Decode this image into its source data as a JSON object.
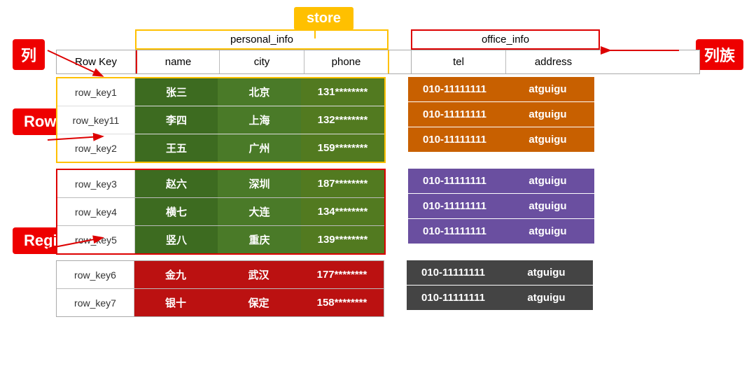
{
  "store_label": "store",
  "lie_label": "列",
  "liezu_label": "列族",
  "rowkey_label": "Row key",
  "region_label": "Region",
  "family_personal": "personal_info",
  "family_office": "office_info",
  "col_headers": [
    "Row Key",
    "name",
    "city",
    "phone",
    "tel",
    "address"
  ],
  "region1": {
    "rows": [
      {
        "key": "row_key1",
        "name": "张三",
        "city": "北京",
        "phone": "131********",
        "tel": "010-11111111",
        "address": "atguigu"
      },
      {
        "key": "row_key11",
        "name": "李四",
        "city": "上海",
        "phone": "132********",
        "tel": "010-11111111",
        "address": "atguigu"
      },
      {
        "key": "row_key2",
        "name": "王五",
        "city": "广州",
        "phone": "159********",
        "tel": "010-11111111",
        "address": "atguigu"
      }
    ]
  },
  "region2": {
    "rows": [
      {
        "key": "row_key3",
        "name": "赵六",
        "city": "深圳",
        "phone": "187********",
        "tel": "010-11111111",
        "address": "atguigu"
      },
      {
        "key": "row_key4",
        "name": "横七",
        "city": "大连",
        "phone": "134********",
        "tel": "010-11111111",
        "address": "atguigu"
      },
      {
        "key": "row_key5",
        "name": "竖八",
        "city": "重庆",
        "phone": "139********",
        "tel": "010-11111111",
        "address": "atguigu"
      }
    ]
  },
  "region3": {
    "rows": [
      {
        "key": "row_key6",
        "name": "金九",
        "city": "武汉",
        "phone": "177********",
        "tel": "010-11111111",
        "address": "atguigu"
      },
      {
        "key": "row_key7",
        "name": "银十",
        "city": "保定",
        "phone": "158********",
        "tel": "010-11111111",
        "address": "atguigu"
      }
    ]
  },
  "colors": {
    "store_bg": "#FFC000",
    "lie_bg": "#dd0000",
    "green_dark": "#3d6b20",
    "green_mid": "#4a7a28",
    "green_light": "#527a20",
    "orange": "#c86000",
    "purple_dark": "#6a4fa0",
    "purple_mid": "#7a5ab0",
    "purple_light": "#8a65c0",
    "red_dark": "#aa1111",
    "red_mid": "#bb2222",
    "dark1": "#444444",
    "dark2": "#333333"
  }
}
